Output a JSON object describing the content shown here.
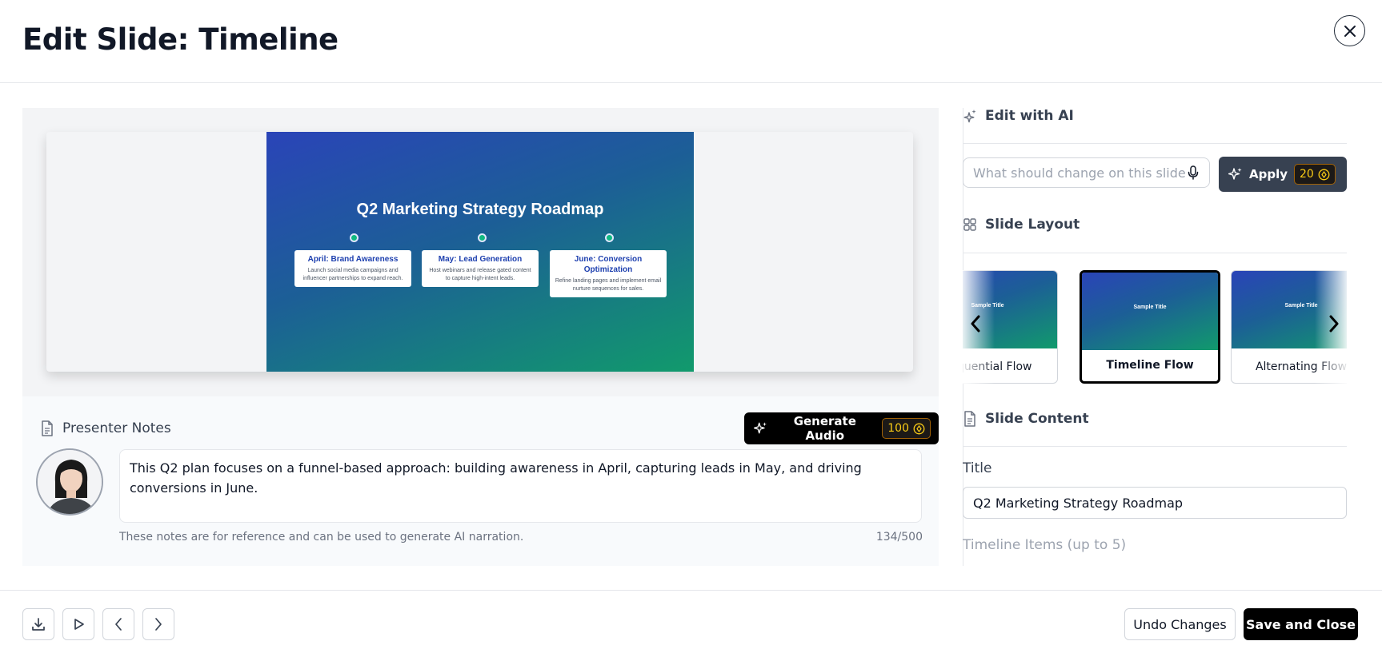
{
  "header": {
    "title": "Edit Slide: Timeline"
  },
  "slide": {
    "title": "Q2 Marketing Strategy Roadmap",
    "timeline": [
      {
        "title": "April: Brand Awareness",
        "desc": "Launch social media campaigns and influencer partnerships to expand reach."
      },
      {
        "title": "May: Lead Generation",
        "desc": "Host webinars and release gated content to capture high-intent leads."
      },
      {
        "title": "June: Conversion Optimization",
        "desc": "Refine landing pages and implement email nurture sequences for sales."
      }
    ],
    "colors": {
      "gradient_start": "#2a44b8",
      "gradient_end": "#119a6c",
      "dot": "#10b981"
    }
  },
  "notes": {
    "label": "Presenter Notes",
    "generate_label": "Generate Audio",
    "generate_cost": "100",
    "text": "This Q2 plan focuses on a funnel-based approach: building awareness in April, capturing leads in May, and driving conversions in June.",
    "hint": "These notes are for reference and can be used to generate AI narration.",
    "count": "134/500"
  },
  "ai": {
    "label": "Edit with AI",
    "placeholder": "What should change on this slide",
    "apply_label": "Apply",
    "apply_cost": "20"
  },
  "layout": {
    "label": "Slide Layout",
    "thumb_text": "Sample Title",
    "options": [
      {
        "name": "Sequential Flow"
      },
      {
        "name": "Timeline Flow",
        "selected": true
      },
      {
        "name": "Alternating Flow"
      }
    ]
  },
  "content": {
    "label": "Slide Content",
    "title_label": "Title",
    "title_value": "Q2 Marketing Strategy Roadmap",
    "items_label": "Timeline Items (up to 5)"
  },
  "footer": {
    "undo_label": "Undo Changes",
    "save_label": "Save and Close"
  },
  "icons": [
    "close-icon",
    "sparkles-icon",
    "microphone-icon",
    "grid-icon",
    "document-icon",
    "coin-icon",
    "chevron-left-icon",
    "chevron-right-icon",
    "download-icon",
    "play-icon"
  ],
  "colors": {
    "accent_gold": "#facc15",
    "primary_dark": "#000000"
  }
}
